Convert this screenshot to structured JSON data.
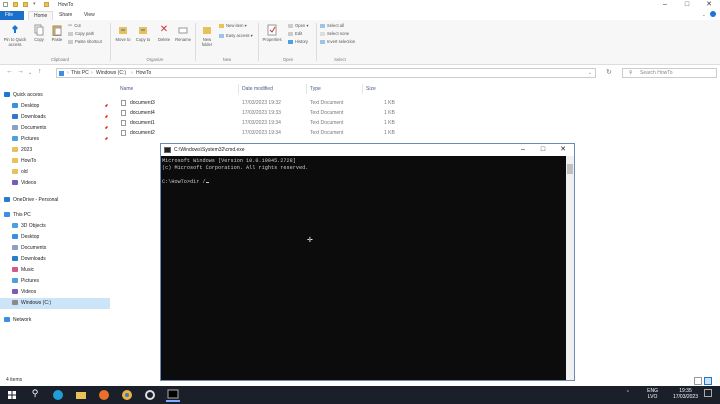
{
  "window": {
    "title": "HowTo"
  },
  "ribbon_tabs": [
    "File",
    "Home",
    "Share",
    "View"
  ],
  "ribbon": {
    "clipboard": {
      "pin": "Pin to Quick access",
      "copy": "Copy",
      "paste": "Paste",
      "cut": "Cut",
      "copy_path": "Copy path",
      "paste_shortcut": "Paste shortcut",
      "group": "Clipboard"
    },
    "organize": {
      "move_to": "Move to",
      "copy_to": "Copy to",
      "delete": "Delete",
      "rename": "Rename",
      "group": "Organize"
    },
    "new": {
      "new_folder": "New folder",
      "new_item": "New item ▾",
      "easy_access": "Easy access ▾",
      "group": "New"
    },
    "open": {
      "properties": "Properties",
      "open": "Open ▾",
      "edit": "Edit",
      "history": "History",
      "group": "Open"
    },
    "select": {
      "select_all": "Select all",
      "select_none": "Select none",
      "invert": "Invert selection",
      "group": "Select"
    }
  },
  "address": {
    "path": [
      "This PC",
      "Windows (C:)",
      "HowTo"
    ],
    "search_placeholder": "Search HowTo"
  },
  "nav": {
    "items": [
      {
        "label": "Quick access",
        "color": "#1a78d4"
      },
      {
        "label": "Desktop",
        "color": "#3a8ee6"
      },
      {
        "label": "Downloads",
        "color": "#2a7bd0"
      },
      {
        "label": "Documents",
        "color": "#8aa2c0"
      },
      {
        "label": "Pictures",
        "color": "#4aa0e0"
      },
      {
        "label": "2023",
        "color": "#e8c15a"
      },
      {
        "label": "HowTo",
        "color": "#e8c15a"
      },
      {
        "label": "old",
        "color": "#e8c15a"
      },
      {
        "label": "Videos",
        "color": "#7a5ab8"
      },
      {
        "label": "OneDrive - Personal",
        "color": "#2a7bd0"
      },
      {
        "label": "This PC",
        "color": "#3a8ee6"
      },
      {
        "label": "3D Objects",
        "color": "#4aa0e0"
      },
      {
        "label": "Desktop",
        "color": "#3a8ee6"
      },
      {
        "label": "Documents",
        "color": "#8aa2c0"
      },
      {
        "label": "Downloads",
        "color": "#2a7bd0"
      },
      {
        "label": "Music",
        "color": "#d05a8a"
      },
      {
        "label": "Pictures",
        "color": "#4aa0e0"
      },
      {
        "label": "Videos",
        "color": "#7a5ab8"
      },
      {
        "label": "Windows (C:)",
        "color": "#8a8a8a"
      },
      {
        "label": "Network",
        "color": "#3a8ee6"
      }
    ]
  },
  "files": {
    "columns": [
      "Name",
      "Date modified",
      "Type",
      "Size"
    ],
    "rows": [
      {
        "name": "document3",
        "date": "17/03/2023 19:32",
        "type": "Text Document",
        "size": "1 KB"
      },
      {
        "name": "document4",
        "date": "17/03/2023 19:33",
        "type": "Text Document",
        "size": "1 KB"
      },
      {
        "name": "document1",
        "date": "17/03/2023 19:34",
        "type": "Text Document",
        "size": "1 KB"
      },
      {
        "name": "document2",
        "date": "17/03/2023 19:34",
        "type": "Text Document",
        "size": "1 KB"
      }
    ]
  },
  "status": {
    "count": "4 items"
  },
  "cmd": {
    "title": "C:\\Windows\\System32\\cmd.exe",
    "lines": [
      "Microsoft Windows [Version 10.0.19045.2728]",
      "(c) Microsoft Corporation. All rights reserved.",
      "",
      "C:\\HowTo>dir /"
    ]
  },
  "taskbar": {
    "lang": "ENG",
    "lang_sub": "LVO",
    "time": "19:35",
    "date": "17/03/2023"
  }
}
